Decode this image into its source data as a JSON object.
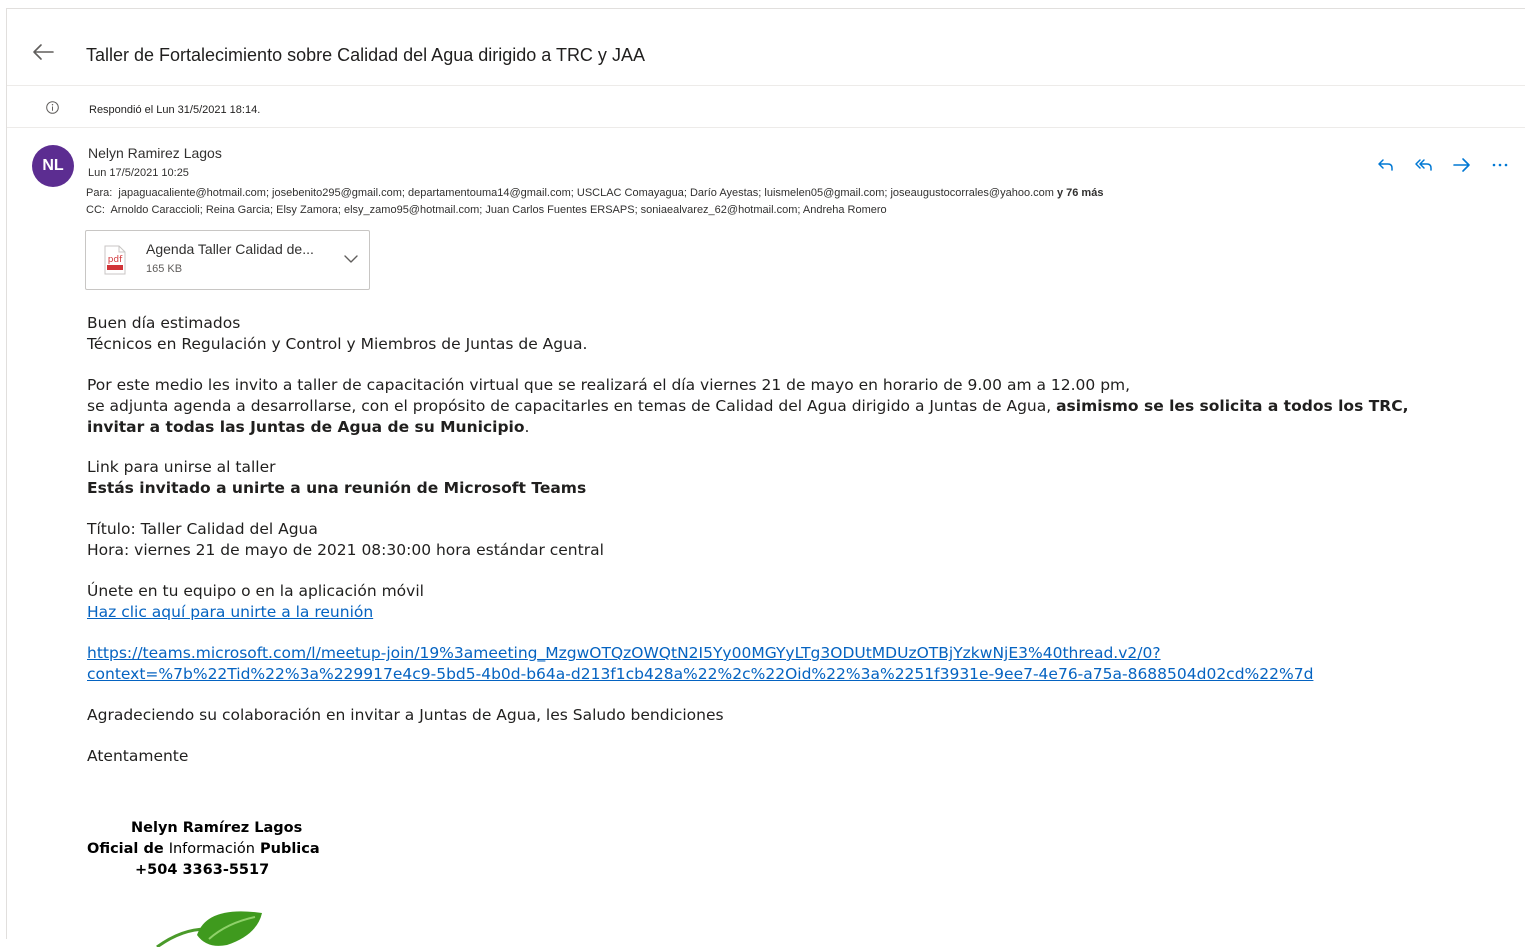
{
  "header": {
    "subject": "Taller de Fortalecimiento sobre Calidad del Agua dirigido a TRC y JAA"
  },
  "info": {
    "text": "Respondió el Lun 31/5/2021 18:14."
  },
  "message": {
    "avatar_initials": "NL",
    "sender": "Nelyn Ramirez Lagos",
    "date": "Lun 17/5/2021 10:25",
    "to_label": "Para:",
    "to_list": "japaguacaliente@hotmail.com; josebenito295@gmail.com; departamentouma14@gmail.com; USCLAC Comayagua; Darío Ayestas; luismelen05@gmail.com; joseaugustocorrales@yahoo.com",
    "to_more": "y 76 más",
    "cc_label": "CC:",
    "cc_list": "Arnoldo Caraccioli; Reina Garcia; Elsy Zamora; elsy_zamo95@hotmail.com; Juan Carlos Fuentes ERSAPS; soniaealvarez_62@hotmail.com; Andreha Romero"
  },
  "attachment": {
    "name": "Agenda Taller Calidad de...",
    "size": "165 KB"
  },
  "body": {
    "greeting_1": "Buen día estimados",
    "greeting_2": "Técnicos en Regulación y Control y Miembros de Juntas de Agua.",
    "para_1": "Por este medio les invito a taller de capacitación virtual que se realizará el día viernes 21 de mayo en horario de 9.00 am a 12.00 pm,",
    "para_2_start": "se adjunta agenda a desarrollarse, con el propósito de capacitarles en temas de Calidad del Agua dirigido a Juntas de Agua, ",
    "para_2_bold": "asimismo se les solicita a todos los TRC,",
    "para_3_bold": "invitar a todas las Juntas de Agua de su Municipio",
    "para_3_end": ".",
    "link_label": "Link para unirse al taller",
    "invite_bold": "Estás invitado a unirte a una reunión de Microsoft Teams",
    "title_line": "Título: Taller Calidad del Agua",
    "time_line": "Hora: viernes 21 de mayo de 2021 08:30:00 hora estándar central",
    "join_line": "Únete en tu equipo o en la aplicación móvil",
    "join_link": "Haz clic aquí para unirte a la reunión",
    "url_1": "https://teams.microsoft.com/l/meetup-join/19%3ameeting_MzgwOTQzOWQtN2I5Yy00MGYyLTg3ODUtMDUzOTBjYzkwNjE3%40thread.v2/0?",
    "url_2": "context=%7b%22Tid%22%3a%229917e4c9-5bd5-4b0d-b64a-d213f1cb428a%22%2c%22Oid%22%3a%2251f3931e-9ee7-4e76-a75a-8688504d02cd%22%7d",
    "thanks": "Agradeciendo su colaboración en invitar a Juntas de Agua, les Saludo bendiciones",
    "closing": "Atentamente"
  },
  "signature": {
    "name": "Nelyn Ramírez Lagos",
    "role_a": "Oficial de ",
    "role_b": "Información",
    "role_c": " Publica",
    "phone": "+504 3363-5517"
  },
  "colors": {
    "avatar_bg": "#5c2d91",
    "link": "#0563c1",
    "action_icons": "#0078d4"
  }
}
